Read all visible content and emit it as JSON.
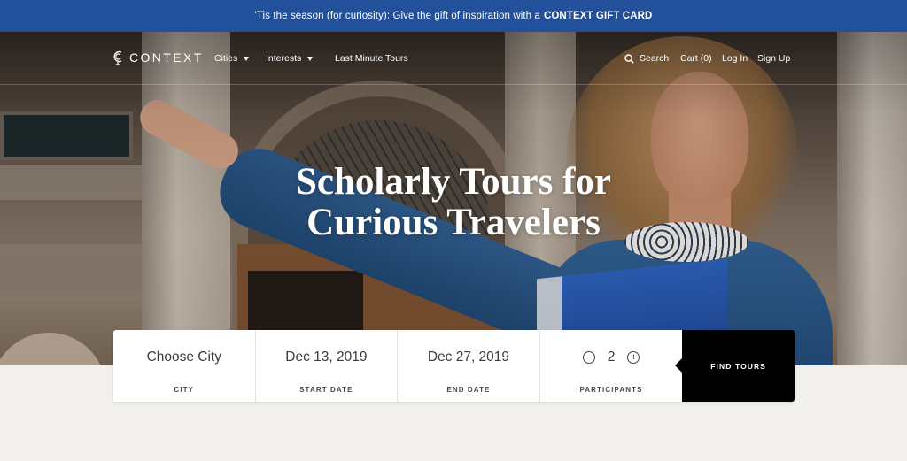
{
  "promo": {
    "text": "'Tis the season (for curiosity): Give the gift of inspiration with a",
    "link": "CONTEXT GIFT CARD"
  },
  "nav": {
    "logo": "CONTEXT",
    "logo_icon": "globe-c-logo-icon",
    "left_items": [
      {
        "label": "Cities",
        "has_dropdown": true
      },
      {
        "label": "Interests",
        "has_dropdown": true
      },
      {
        "label": "Last Minute Tours",
        "has_dropdown": false
      }
    ],
    "search_label": "Search",
    "search_icon": "search-icon",
    "cart_label": "Cart (0)",
    "login_label": "Log In",
    "signup_label": "Sign Up"
  },
  "hero": {
    "title_line1": "Scholarly Tours for",
    "title_line2": "Curious Travelers",
    "image_description": "Tour guide in blue cardigan pointing, holding blue binder, in front of stone building with arched doorway"
  },
  "search": {
    "city": {
      "value": "Choose City",
      "label": "CITY"
    },
    "start_date": {
      "value": "Dec 13, 2019",
      "label": "START DATE"
    },
    "end_date": {
      "value": "Dec 27, 2019",
      "label": "END DATE"
    },
    "participants": {
      "value": "2",
      "label": "PARTICIPANTS",
      "decrement_icon": "minus-circle-icon",
      "increment_icon": "plus-circle-icon"
    },
    "submit_label": "FIND TOURS"
  },
  "colors": {
    "promo_bg": "#23509a",
    "page_bg": "#f2f0ed",
    "button_bg": "#000000"
  }
}
